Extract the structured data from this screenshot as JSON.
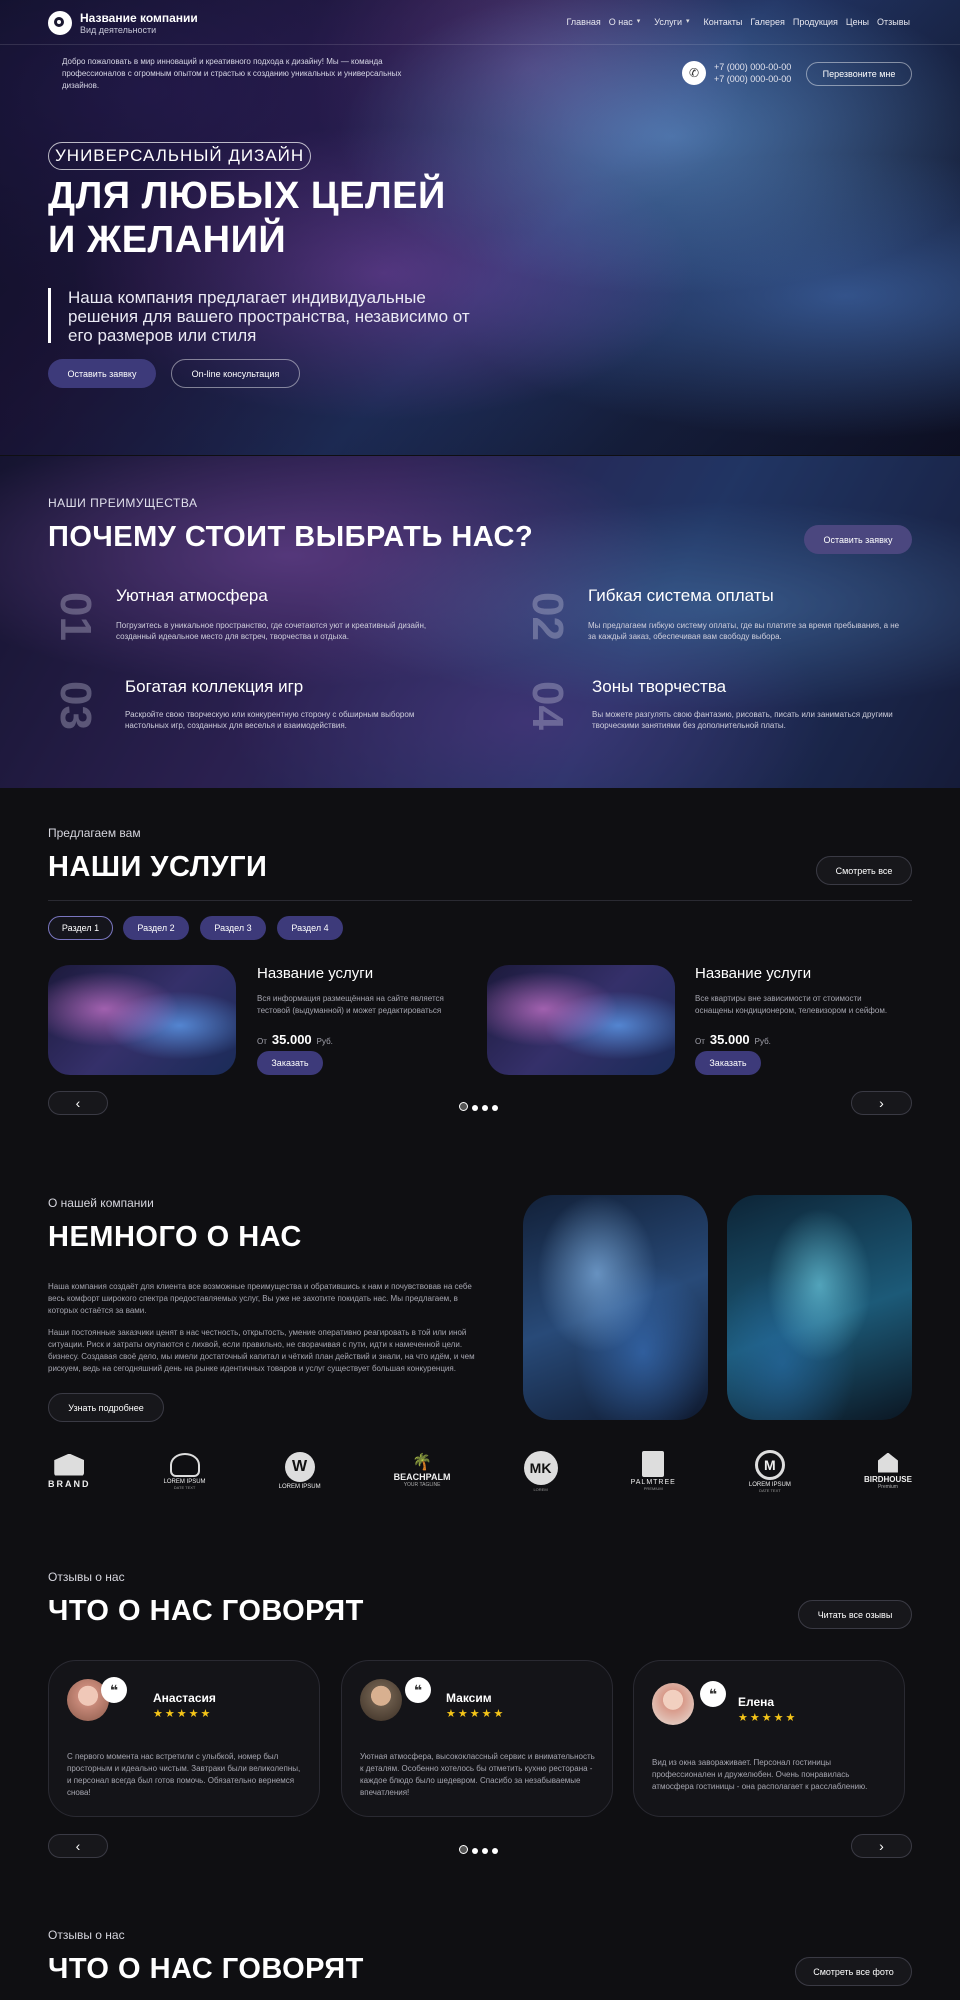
{
  "header": {
    "company_name": "Название компании",
    "company_tagline": "Вид деятельности",
    "intro": "Добро пожаловать в мир инноваций и креативного подхода к дизайну! Мы — команда профессионалов с огромным опытом и страстью к созданию уникальных и универсальных дизайнов.",
    "nav": [
      "Главная",
      "О нас",
      "Услуги",
      "Контакты",
      "Галерея",
      "Продукция",
      "Цены",
      "Отзывы"
    ],
    "phone1": "+7 (000) 000-00-00",
    "phone2": "+7 (000) 000-00-00",
    "callback": "Перезвоните мне"
  },
  "hero": {
    "badge": "УНИВЕРСАЛЬНЫЙ ДИЗАЙН",
    "title1": "ДЛЯ ЛЮБЫХ ЦЕЛЕЙ",
    "title2": "И ЖЕЛАНИЙ",
    "text": "Наша компания предлагает индивидуальные решения для вашего пространства, независимо от его размеров или стиля",
    "btn_primary": "Оставить заявку",
    "btn_secondary": "On-line консультация"
  },
  "advantages": {
    "eyebrow": "НАШИ ПРЕИМУЩЕСТВА",
    "title": "ПОЧЕМУ СТОИТ ВЫБРАТЬ НАС?",
    "button": "Оставить заявку",
    "items": [
      {
        "num": "01",
        "title": "Уютная атмосфера",
        "text": "Погрузитесь в уникальное пространство, где сочетаются уют и креативный дизайн, созданный идеальное место для встреч, творчества и отдыха."
      },
      {
        "num": "02",
        "title": "Гибкая система оплаты",
        "text": "Мы предлагаем гибкую систему оплаты, где вы платите за время пребывания, а не за каждый заказ, обеспечивая вам свободу выбора."
      },
      {
        "num": "03",
        "title": "Богатая коллекция игр",
        "text": "Раскройте свою творческую или конкурентную сторону с обширным выбором настольных игр, созданных для веселья и взаимодействия."
      },
      {
        "num": "04",
        "title": "Зоны творчества",
        "text": "Вы можете разгулять свою фантазию, рисовать, писать или заниматься другими творческими занятиями без дополнительной платы."
      }
    ]
  },
  "services": {
    "eyebrow": "Предлагаем вам",
    "title": "НАШИ УСЛУГИ",
    "view_all": "Смотреть все",
    "tabs": [
      "Раздел 1",
      "Раздел 2",
      "Раздел 3",
      "Раздел 4"
    ],
    "items": [
      {
        "title": "Название услуги",
        "text": "Вся информация размещённая на сайте является тестовой (выдуманной) и может редактироваться",
        "price_prefix": "От",
        "price": "35.000",
        "currency": "Руб.",
        "button": "Заказать"
      },
      {
        "title": "Название услуги",
        "text": "Все квартиры вне зависимости от стоимости оснащены кондиционером, телевизором и сейфом.",
        "price_prefix": "От",
        "price": "35.000",
        "currency": "Руб.",
        "button": "Заказать"
      }
    ],
    "prev": "‹",
    "next": "›"
  },
  "about": {
    "eyebrow": "О нашей компании",
    "title": "НЕМНОГО О НАС",
    "p1": "Наша компания создаёт для клиента все возможные преимущества и  обратившись к нам и почувствовав на себе весь комфорт широкого спектра предоставляемых услуг, Вы уже не захотите покидать нас. Мы предлагаем, в которых остаётся за вами.",
    "p2": "Наши постоянные заказчики ценят в нас честность, открытость, умение оперативно реагировать в той или иной ситуации. Риск и затраты окупаются с лихвой, если правильно, не сворачивая с пути, идти к намеченной цели. бизнесу. Создавая своё дело, мы имели достаточный капитал и чёткий план действий и знали, на что идём, и чем рискуем, ведь на сегодняшний день на рынке идентичных товаров и услуг существует большая конкуренция.",
    "button": "Узнать подробнее"
  },
  "logos": [
    {
      "icon": "handshake-icon",
      "name": "BRAND",
      "sub": ""
    },
    {
      "icon": "palm-icon",
      "name": "LOREM IPSUM",
      "sub": "DATE TEXT"
    },
    {
      "icon": "w-icon",
      "name": "LOREM IPSUM",
      "sub": ""
    },
    {
      "icon": "palm-tree-icon",
      "name": "BEACHPALM",
      "sub": "YOUR TAGLINE"
    },
    {
      "icon": "mk-icon",
      "name": "MK",
      "sub": "LOREM"
    },
    {
      "icon": "palmtree-icon",
      "name": "PALMTREE",
      "sub": "PREMIUM"
    },
    {
      "icon": "m-icon",
      "name": "LOREM IPSUM",
      "sub": "DATE TEXT"
    },
    {
      "icon": "birdhouse-icon",
      "name": "BIRDHOUSE",
      "sub": "Premium"
    }
  ],
  "reviews": {
    "eyebrow": "Отзывы о нас",
    "title": "ЧТО О НАС ГОВОРЯТ",
    "read_all": "Читать все озывы",
    "items": [
      {
        "name": "Анастасия",
        "text": "С первого момента нас встретили с улыбкой, номер был просторным и идеально чистым. Завтраки были великолепны, и персонал всегда был готов помочь. Обязательно вернемся снова!",
        "avatar_color": "#c98a7a"
      },
      {
        "name": "Максим",
        "text": "Уютная атмосфера, высококлассный сервис и внимательность к деталям. Особенно хотелось бы отметить кухню ресторана - каждое блюдо было шедевром. Спасибо за незабываемые впечатления!",
        "avatar_color": "#7a6a5a"
      },
      {
        "name": "Елена",
        "text": "Вид из окна завораживает. Персонал гостиницы профессионален и дружелюбен. Очень понравилась атмосфера гостиницы - она располагает к расслаблению.",
        "avatar_color": "#d89a8a"
      }
    ],
    "stars": "★★★★★",
    "quote_mark": "❝",
    "prev": "‹",
    "next": "›"
  },
  "reviews2": {
    "eyebrow": "Отзывы о нас",
    "title": "ЧТО О НАС ГОВОРЯТ",
    "button": "Смотреть все фото"
  }
}
